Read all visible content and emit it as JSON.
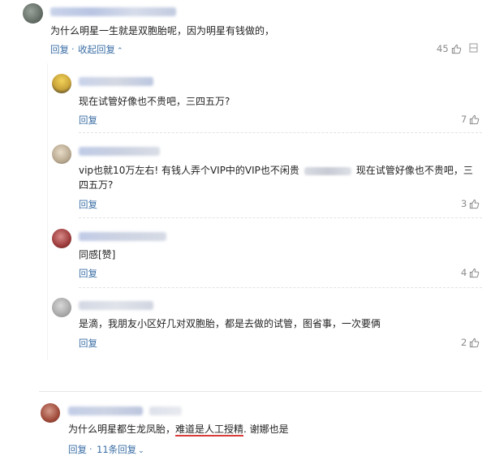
{
  "thread": {
    "main_comment": {
      "text": "为什么明星一生就是双胞胎呢，因为明星有钱做的，",
      "reply_label": "回复",
      "separator": "·",
      "collapse_label": "收起回复",
      "likes": "45"
    },
    "replies": [
      {
        "text": "现在试管好像也不贵吧，三四五万?",
        "reply_label": "回复",
        "likes": "7"
      },
      {
        "text_line1_a": "vip也就10万左右! 有钱人弄个VIP中的VIP也不闲贵",
        "text_line1_b": "现在试管好像也不贵吧，三",
        "text_line2": "四五万?",
        "reply_label": "回复",
        "likes": "3"
      },
      {
        "text": "同感[赞]",
        "reply_label": "回复",
        "likes": "4"
      },
      {
        "text": "是滴，我朋友小区好几对双胞胎，都是去做的试管，图省事，一次要俩",
        "reply_label": "回复",
        "likes": "2"
      }
    ],
    "second_comment": {
      "text_a": "为什么明星都生龙凤胎，",
      "text_highlight": "难道是人工授精",
      "text_b": ". 谢娜也是",
      "reply_label": "回复",
      "separator": "·",
      "replies_count_label": "11条回复"
    }
  },
  "icons": {
    "like": "thumbs-up-icon",
    "expand": "chevron-down-icon",
    "collapse": "chevron-up-icon"
  },
  "colors": {
    "link": "#3a6ea5",
    "underline": "#d93a3a",
    "muted": "#8a8a8a"
  }
}
